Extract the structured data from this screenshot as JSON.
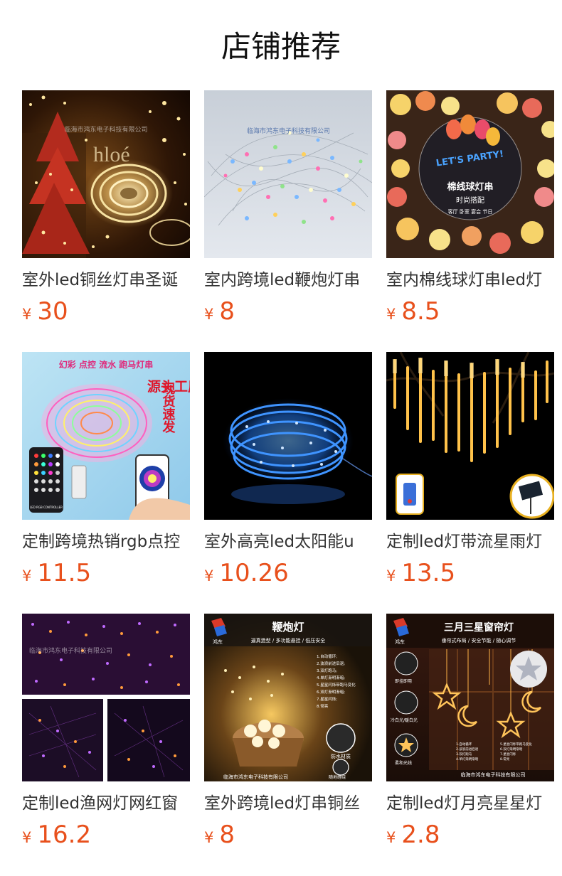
{
  "page": {
    "title": "店铺推荐"
  },
  "accent_color": "#e8501c",
  "products": [
    {
      "name": "室外led铜丝灯串圣诞",
      "currency": "¥",
      "price": "30",
      "image": {
        "icon": "product-image-copper-wire-fairy-lights",
        "watermark": "临海市鸿东电子科技有限公司"
      }
    },
    {
      "name": "室内跨境led鞭炮灯串",
      "currency": "¥",
      "price": "8",
      "image": {
        "icon": "product-image-firecracker-lights",
        "watermark": "临海市鸿东电子科技有限公司"
      }
    },
    {
      "name": "室内棉线球灯串led灯",
      "currency": "¥",
      "price": "8.5",
      "image": {
        "icon": "product-image-cotton-ball-lights",
        "badge_title": "棉线球灯串",
        "badge_subtitle": "时尚搭配",
        "badge_tags": "客厅 卧室 宴会 节日",
        "party_text": "LET'S PARTY!"
      }
    },
    {
      "name": "定制跨境热销rgb点控",
      "currency": "¥",
      "price": "11.5",
      "image": {
        "icon": "product-image-rgb-app-controlled-lights",
        "banner": "幻彩 点控 流水 跑马灯串",
        "side_left": "源头工厂",
        "side_right": "现货速发",
        "controller_label": "LED RGB CONTROLLER"
      }
    },
    {
      "name": "室外高亮led太阳能u",
      "currency": "¥",
      "price": "10.26",
      "image": {
        "icon": "product-image-blue-solar-wire-lights"
      }
    },
    {
      "name": "定制led灯带流星雨灯",
      "currency": "¥",
      "price": "13.5",
      "image": {
        "icon": "product-image-meteor-shower-lights"
      }
    },
    {
      "name": "定制led渔网灯网红窗",
      "currency": "¥",
      "price": "16.2",
      "image": {
        "icon": "product-image-fishing-net-lights",
        "watermark": "临海市鸿东电子科技有限公司"
      }
    },
    {
      "name": "室外跨境led灯串铜丝",
      "currency": "¥",
      "price": "8",
      "image": {
        "icon": "product-image-firecracker-lamp-poster",
        "brand": "鸿东",
        "heading": "鞭炮灯",
        "subheading": "逼真造型 / 多功能悬挂 / 低压安全",
        "modes": [
          "1.自动循环;",
          "2.波浪前进后退;",
          "3.双灯跑马;",
          "4.单灯渐明渐暗;",
          "5.星星闪烁带跑马变化",
          "6.双灯渐明渐暗;",
          "7.星星闪烁;",
          "8.常亮"
        ],
        "badge_1": "防水材质",
        "badge_2": "随地缠绕",
        "footer": "临海市鸿东电子科技有限公司"
      }
    },
    {
      "name": "定制led灯月亮星星灯",
      "currency": "¥",
      "price": "2.8",
      "image": {
        "icon": "product-image-star-moon-curtain-lights",
        "brand": "鸿东",
        "heading": "三月三星窗帘灯",
        "subheading": "垂帘式布局 / 安全节能 / 随心调节",
        "side_1": "即挂即用",
        "side_2": "冷白光/暖白光",
        "side_3": "柔和光线",
        "modes": [
          "1.自动循环",
          "2.波浪前进后退",
          "3.双灯跑马",
          "4.单灯渐明渐暗",
          "5.星星闪烁带跑马变化",
          "6.双灯渐明渐暗",
          "7.星星闪烁",
          "8.常亮"
        ],
        "footer": "临海市鸿东电子科技有限公司"
      }
    }
  ]
}
